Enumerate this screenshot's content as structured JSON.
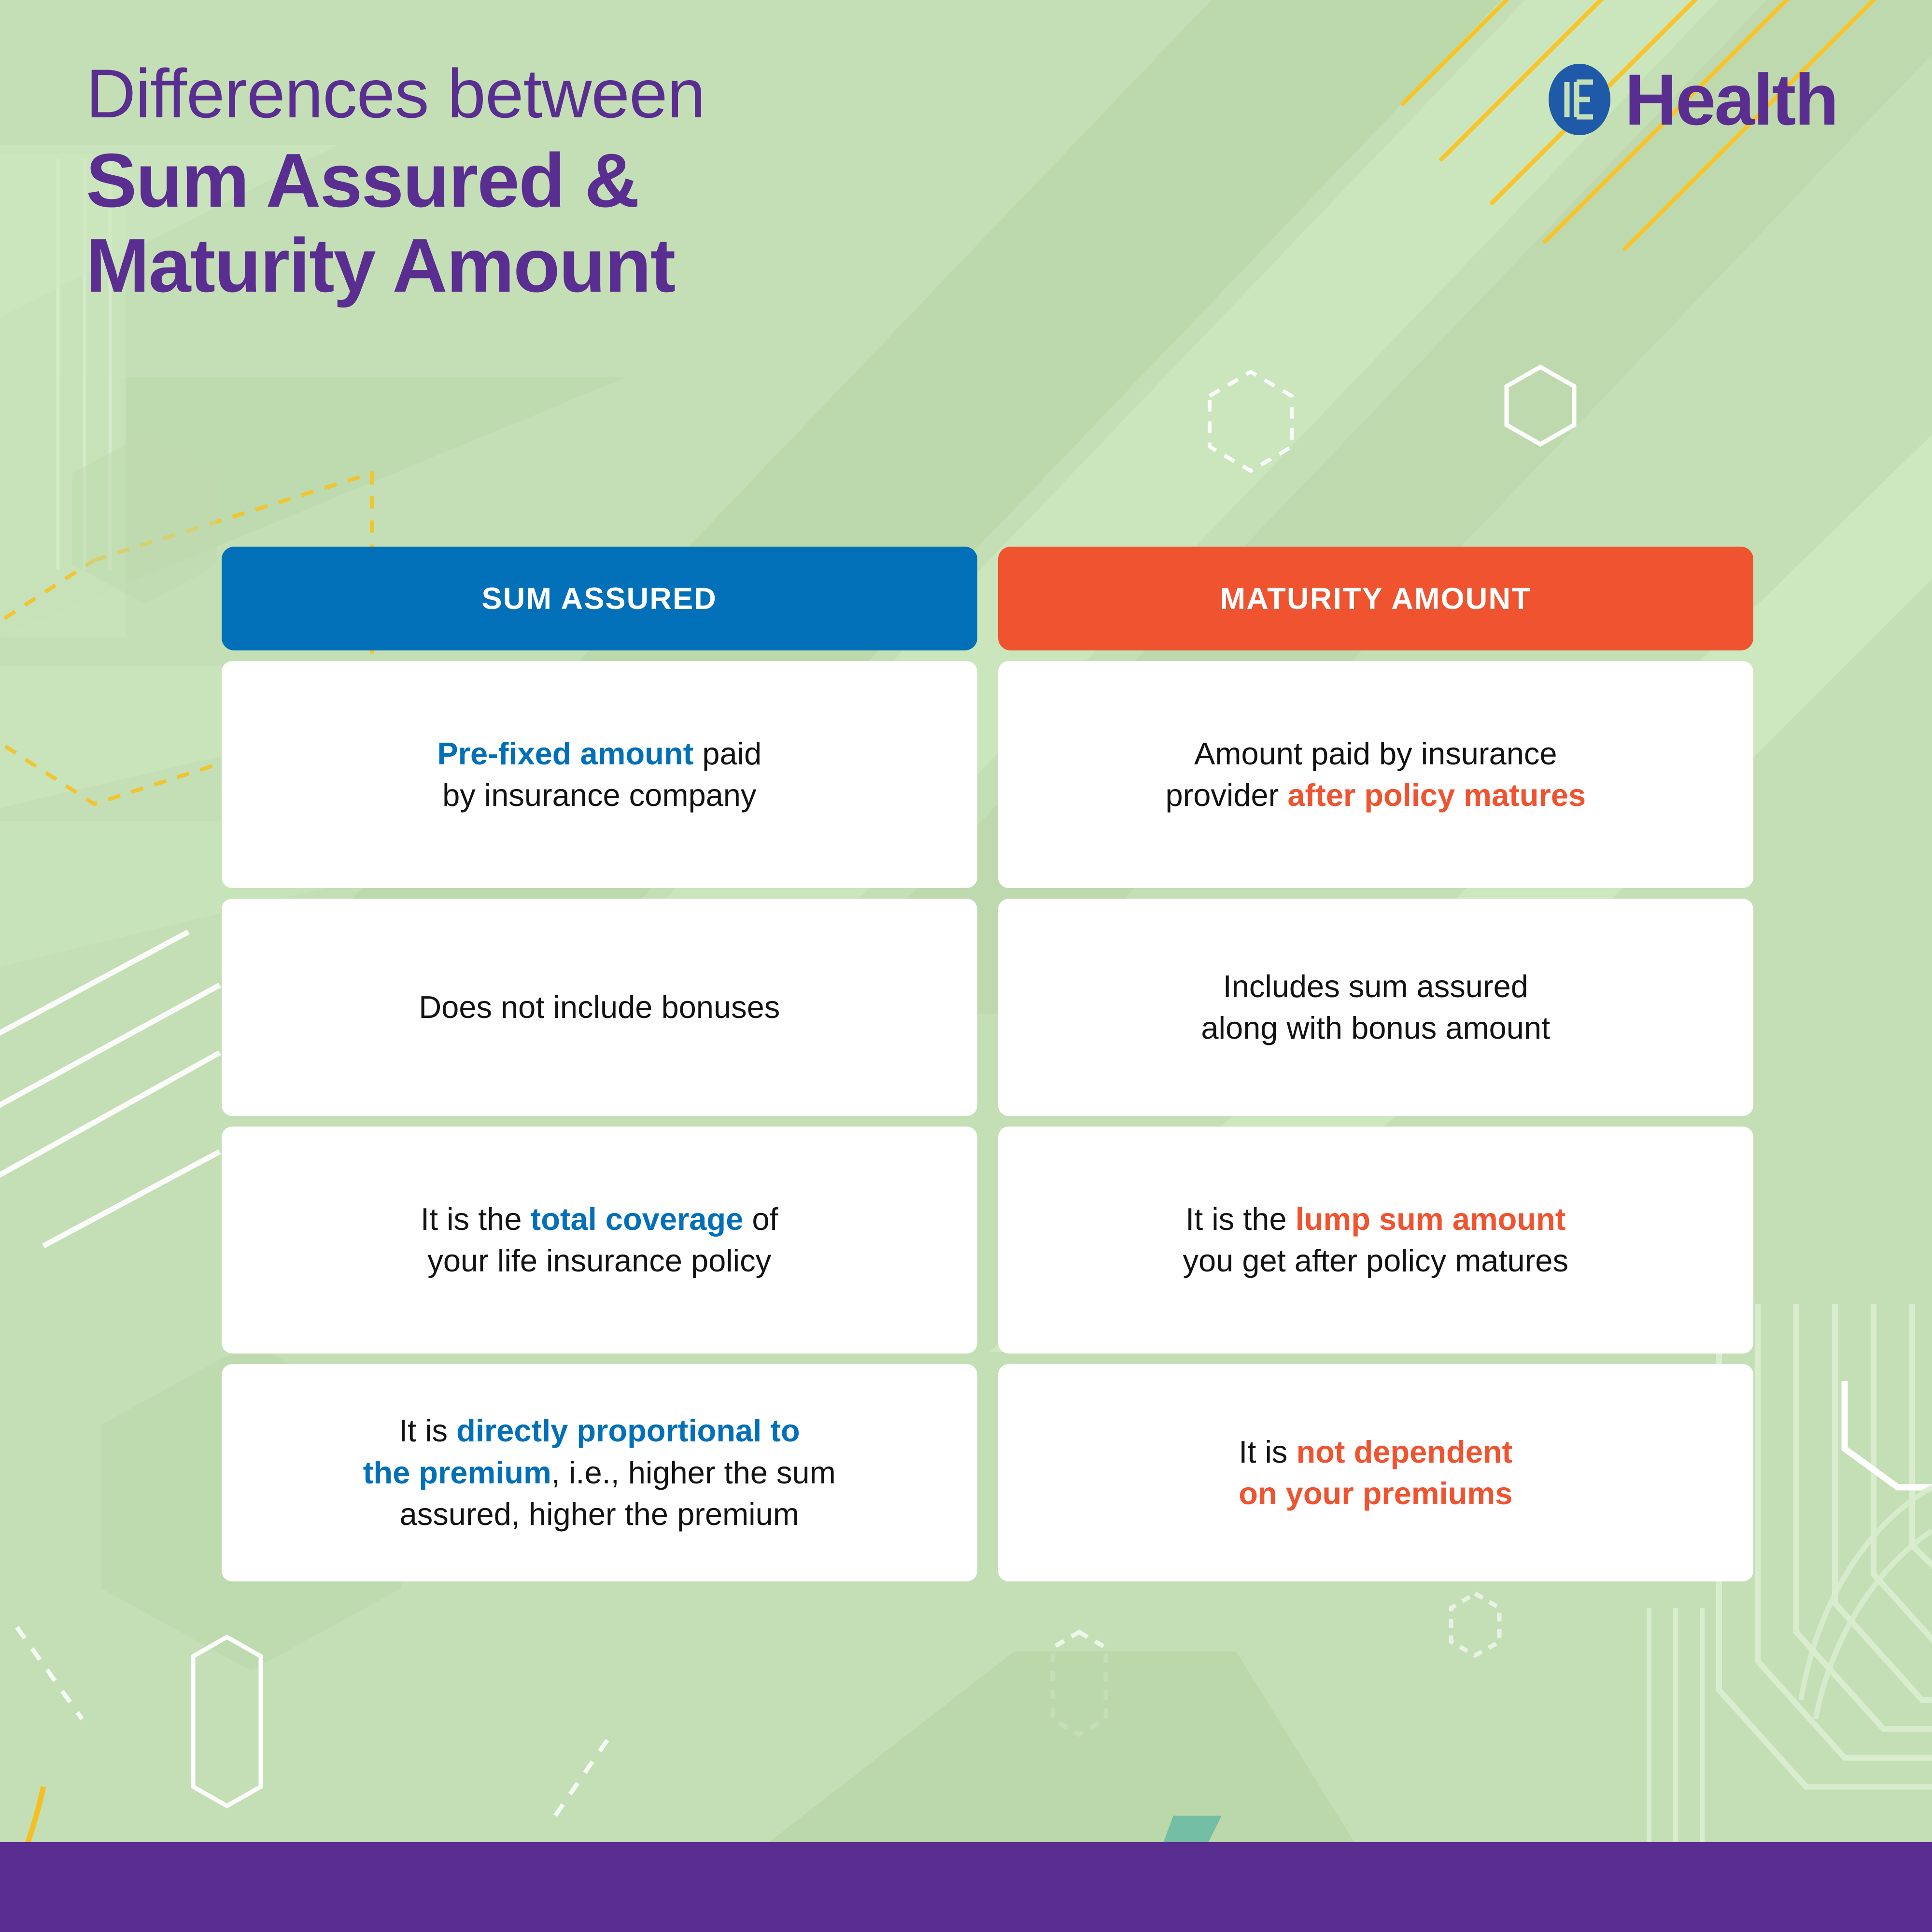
{
  "header": {
    "title_line1": "Differences between",
    "title_line2": "Sum Assured &",
    "title_line3": "Maturity Amount",
    "logo_word": "Health",
    "logo_mark_name": "bajaj-b-monogram-icon"
  },
  "colors": {
    "background_green": "#c4dfb6",
    "brand_purple": "#5a2d91",
    "sum_assured_blue": "#0270b8",
    "maturity_orange": "#f0532f",
    "card_white": "#ffffff",
    "accent_yellow": "#f5c518",
    "logo_blue": "#1f5aa8"
  },
  "table": {
    "headers": [
      {
        "label": "SUM ASSURED",
        "color": "#0270b8"
      },
      {
        "label": "MATURITY AMOUNT",
        "color": "#f0532f"
      }
    ],
    "rows": [
      {
        "sum_assured": {
          "line1_highlight": "Pre-fixed amount",
          "line1_rest": " paid",
          "line2": "by insurance company"
        },
        "maturity": {
          "line1": "Amount paid by insurance",
          "line2_rest": "provider ",
          "line2_highlight": "after policy matures"
        }
      },
      {
        "sum_assured": {
          "line1_highlight": "",
          "line1_rest": "Does not include bonuses",
          "line2": ""
        },
        "maturity": {
          "line1": "Includes sum assured",
          "line2_rest": "along with bonus amount",
          "line2_highlight": ""
        }
      },
      {
        "sum_assured": {
          "line1_pre": "It is the ",
          "line1_highlight": "total coverage",
          "line1_rest": " of",
          "line2": "your life insurance policy"
        },
        "maturity": {
          "line1_pre": "It is the ",
          "line1_highlight": "lump sum amount",
          "line1_rest": "",
          "line2": "you get after policy matures"
        }
      },
      {
        "sum_assured": {
          "line1_pre": "It is ",
          "line1_highlight": "directly proportional to",
          "line2_highlight": "the premium",
          "line2_rest": ", i.e., higher the sum",
          "line3": "assured, higher the premium"
        },
        "maturity": {
          "line1_pre": "It is ",
          "line1_highlight": "not dependent",
          "line2_highlight": "on your premiums"
        }
      }
    ]
  },
  "footer": {
    "bar_color": "#5a2d91"
  }
}
